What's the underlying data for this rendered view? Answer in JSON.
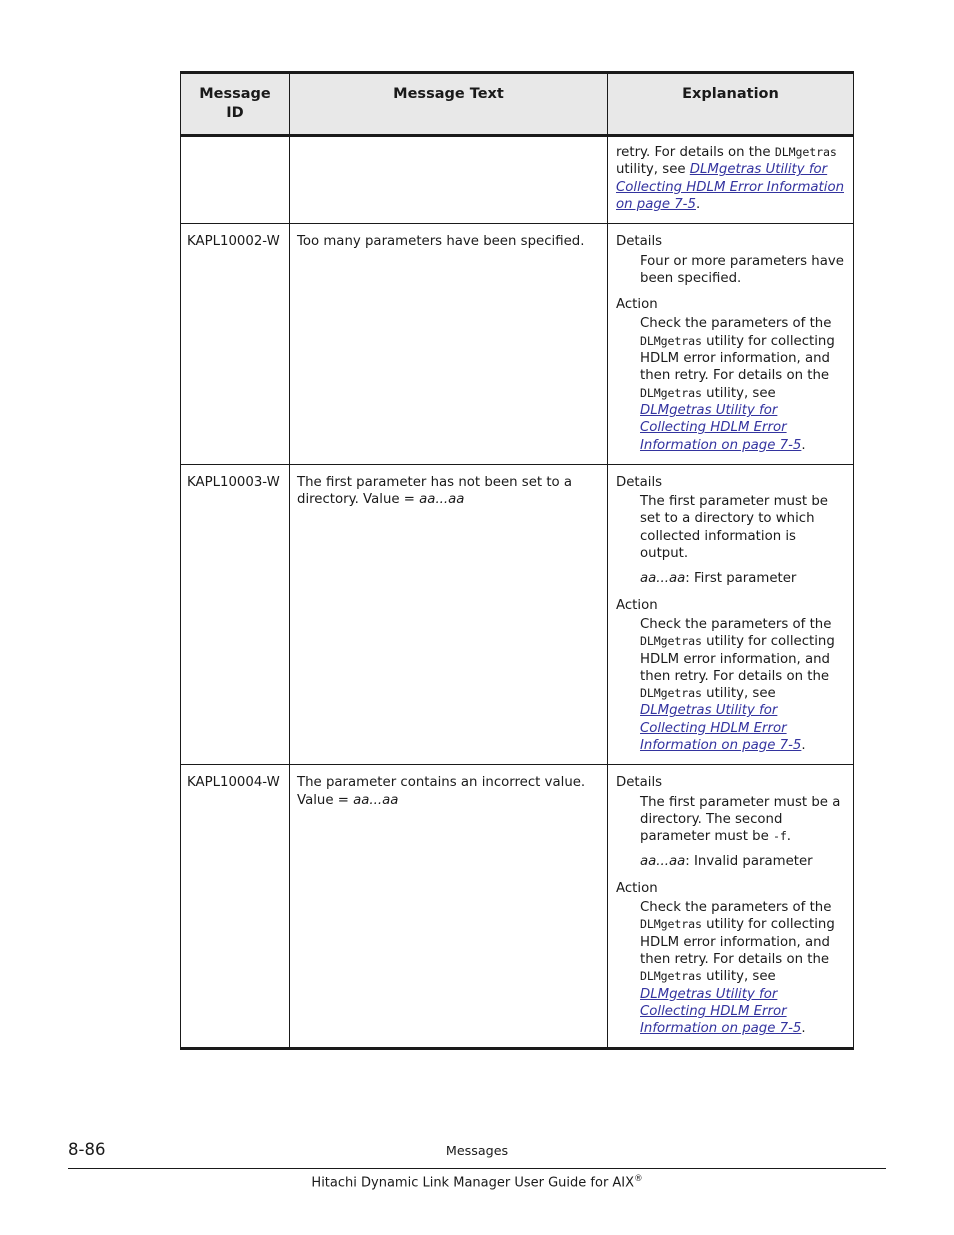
{
  "document": {
    "page_number": "8-86",
    "section": "Messages",
    "guide_title": "Hitachi Dynamic Link Manager User Guide for AIX",
    "guide_title_superscript": "®"
  },
  "table": {
    "headers": {
      "id": "Message\nID",
      "id_line1": "Message",
      "id_line2": "ID",
      "text": "Message Text",
      "explanation": "Explanation"
    },
    "xref_color": "#33339f",
    "header_bg": "#e8e8e8",
    "rows": [
      {
        "id": "",
        "message_text": "",
        "continued": true,
        "explanation_blocks": [
          {
            "heading": "",
            "body_prefix": "retry. For details on the ",
            "body_mono": "DLMgetras",
            "body_mid": " utility, see ",
            "xref": "DLMgetras Utility for Collecting HDLM Error Information on page 7-5",
            "body_suffix": "."
          }
        ]
      },
      {
        "id": "KAPL10002-W",
        "message_text": "Too many parameters have been specified.",
        "continued": false,
        "explanation_blocks": [
          {
            "heading": "Details",
            "body": "Four or more parameters have been specified."
          },
          {
            "heading": "Action",
            "body_prefix": "Check the parameters of the ",
            "body_mono": "DLMgetras",
            "body_mid": " utility for collecting HDLM error information, and then retry. For details on the ",
            "body_mono2": "DLMgetras",
            "body_mid2": " utility, see ",
            "xref": "DLMgetras Utility for Collecting HDLM Error Information on page 7-5",
            "body_suffix": "."
          }
        ]
      },
      {
        "id": "KAPL10003-W",
        "message_text_prefix": "The first parameter has not been set to a directory. Value = ",
        "message_text_italic": "aa...aa",
        "continued": false,
        "explanation_blocks": [
          {
            "heading": "Details",
            "body": "The first parameter must be set to a directory to which collected information is output.",
            "extra_italic": "aa...aa",
            "extra_text": ": First parameter"
          },
          {
            "heading": "Action",
            "body_prefix": "Check the parameters of the ",
            "body_mono": "DLMgetras",
            "body_mid": " utility for collecting HDLM error information, and then retry. For details on the ",
            "body_mono2": "DLMgetras",
            "body_mid2": " utility, see ",
            "xref": "DLMgetras Utility for Collecting HDLM Error Information on page 7-5",
            "body_suffix": "."
          }
        ]
      },
      {
        "id": "KAPL10004-W",
        "message_text_prefix": "The parameter contains an incorrect value. Value = ",
        "message_text_italic": "aa...aa",
        "continued": false,
        "explanation_blocks": [
          {
            "heading": "Details",
            "body_prefix": "The first parameter must be a directory. The second parameter must be ",
            "body_mono": "-f",
            "body_suffix": ".",
            "extra_italic": "aa...aa",
            "extra_text": ": Invalid parameter"
          },
          {
            "heading": "Action",
            "body_prefix": "Check the parameters of the ",
            "body_mono": "DLMgetras",
            "body_mid": " utility for collecting HDLM error information, and then retry. For details on the ",
            "body_mono2": "DLMgetras",
            "body_mid2": " utility, see ",
            "xref": "DLMgetras Utility for Collecting HDLM Error Information on page 7-5",
            "body_suffix": "."
          }
        ]
      }
    ]
  }
}
